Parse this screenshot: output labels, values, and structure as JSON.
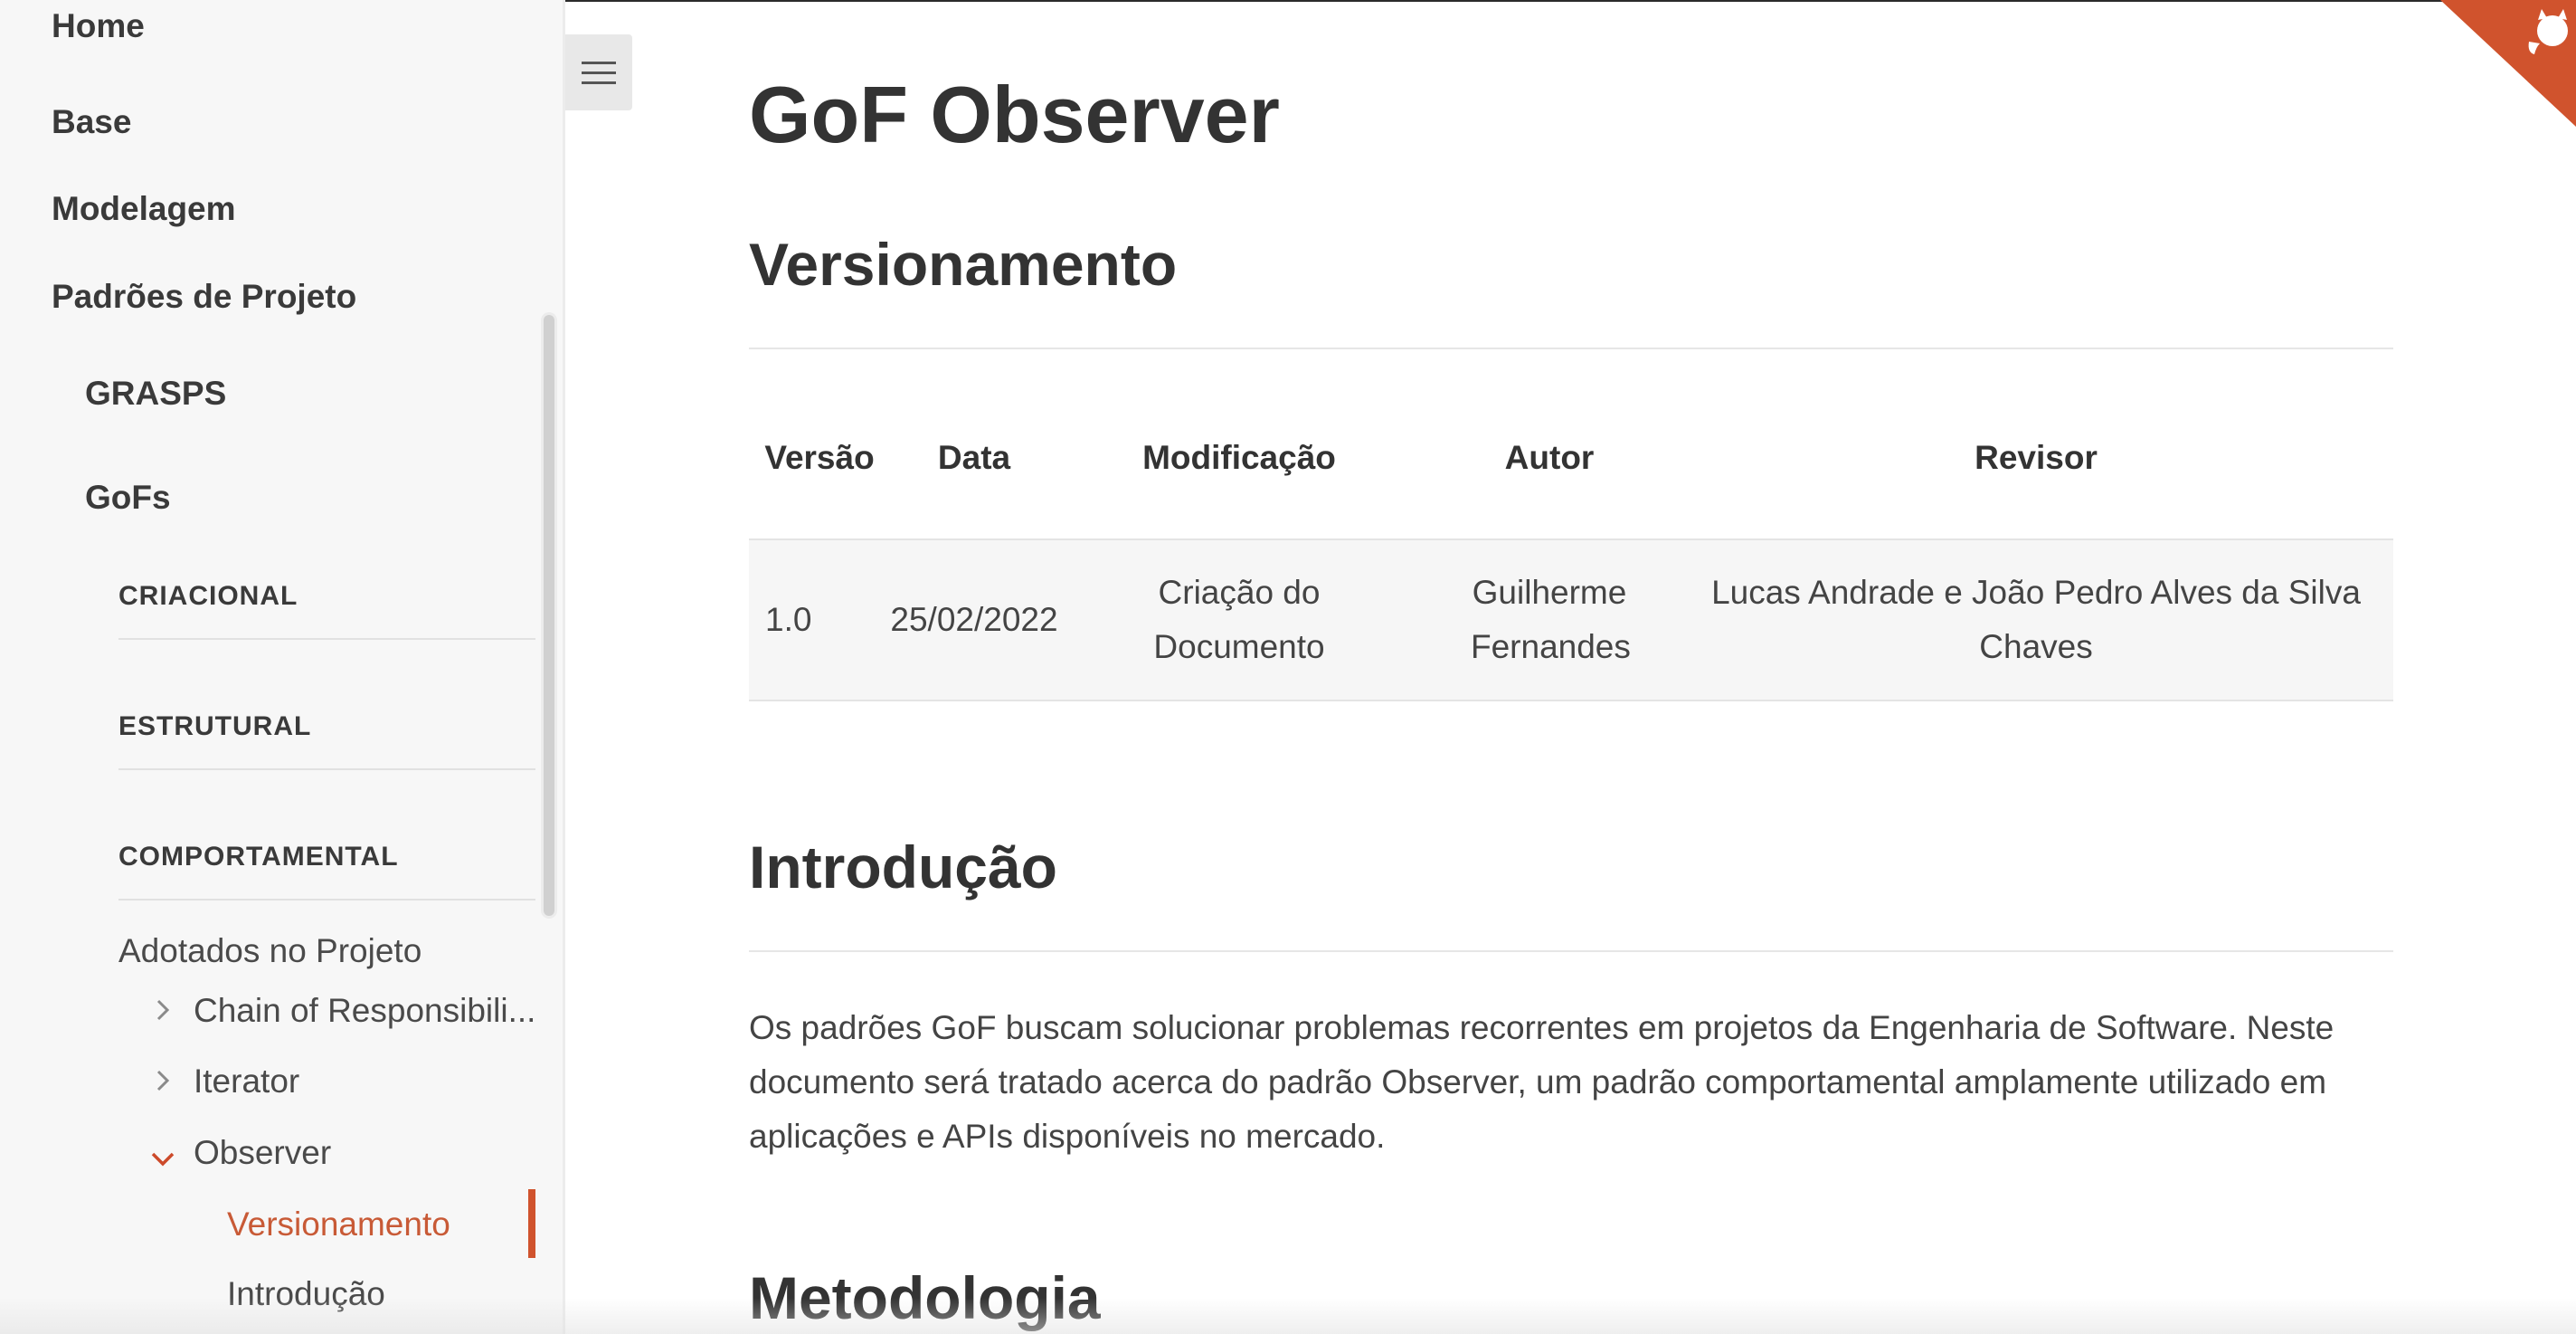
{
  "sidebar": {
    "items": [
      {
        "label": "Home"
      },
      {
        "label": "Base"
      },
      {
        "label": "Modelagem"
      },
      {
        "label": "Padrões de Projeto"
      }
    ],
    "subitems": [
      {
        "label": "GRASPS"
      },
      {
        "label": "GoFs"
      }
    ],
    "sections": [
      {
        "label": "CRIACIONAL"
      },
      {
        "label": "ESTRUTURAL"
      },
      {
        "label": "COMPORTAMENTAL"
      }
    ],
    "group_label": "Adotados no Projeto",
    "patterns": [
      {
        "label": "Chain of Responsibili...",
        "icon": "chevron-right-icon"
      },
      {
        "label": "Iterator",
        "icon": "chevron-right-icon"
      },
      {
        "label": "Observer",
        "icon": "chevron-down-icon"
      }
    ],
    "toc": [
      {
        "label": "Versionamento",
        "active": true
      },
      {
        "label": "Introdução",
        "active": false
      }
    ]
  },
  "toolbar": {
    "menu_icon": "hamburger-icon"
  },
  "page": {
    "title": "GoF Observer",
    "sections": {
      "versionamento": "Versionamento",
      "introducao": "Introdução",
      "metodologia": "Metodologia"
    },
    "intro_paragraph": "Os padrões GoF buscam solucionar problemas recorrentes em projetos da Engenharia de Software. Neste documento será tratado acerca do padrão Observer, um padrão comportamental amplamente utilizado em aplicações e APIs disponíveis no mercado."
  },
  "table": {
    "headers": [
      "Versão",
      "Data",
      "Modificação",
      "Autor",
      "Revisor"
    ],
    "rows": [
      [
        "1.0",
        "25/02/2022",
        "Criação do Documento",
        "Guilherme Fernandes",
        "Lucas Andrade e João Pedro Alves da Silva Chaves"
      ]
    ]
  },
  "colors": {
    "accent": "#d0532d",
    "sidebar_bg": "#f7f7f7"
  },
  "corner": {
    "icon": "github-octocat-icon"
  }
}
